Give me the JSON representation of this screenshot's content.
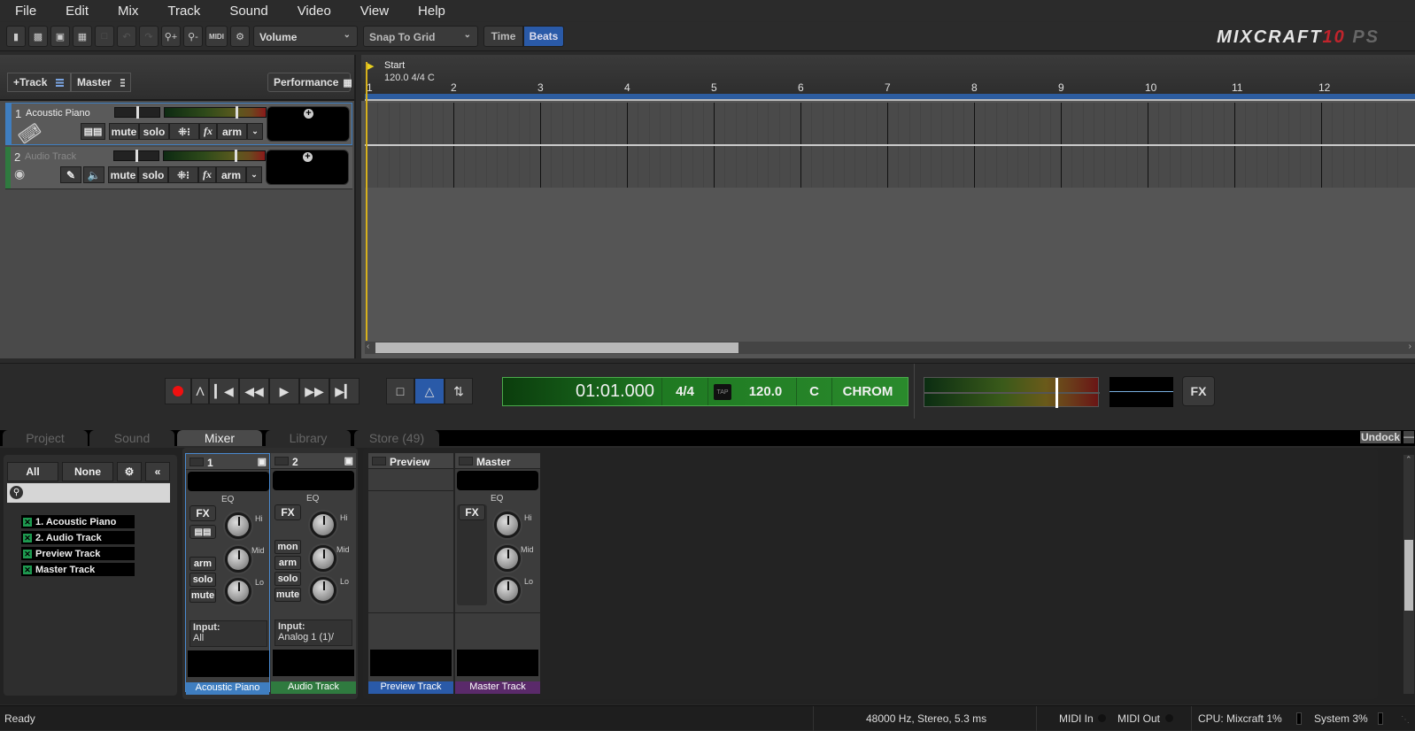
{
  "menu": [
    "File",
    "Edit",
    "Mix",
    "Track",
    "Sound",
    "Video",
    "View",
    "Help"
  ],
  "toolbar": {
    "icons": [
      "new-file-icon",
      "open-folder-icon",
      "open-project-icon",
      "save-icon",
      "crop-icon",
      "undo-icon",
      "redo-icon",
      "zoom-in-icon",
      "zoom-out-icon",
      "midi-icon",
      "settings-icon"
    ],
    "midi_label": "MIDI",
    "automation_dropdown": "Volume",
    "snap_dropdown": "Snap To Grid",
    "time_label": "Time",
    "beats_label": "Beats",
    "beats_active": true
  },
  "logo": {
    "name": "MIXCRAFT",
    "version": "10",
    "edition": "PS"
  },
  "track_panel": {
    "add_track": "+Track",
    "master": "Master",
    "performance": "Performance",
    "tracks": [
      {
        "num": "1",
        "name": "Acoustic Piano",
        "color": "#3f7ec0",
        "type": "instrument",
        "buttons": [
          "mute",
          "solo",
          "fx",
          "arm"
        ]
      },
      {
        "num": "2",
        "name": "Audio Track",
        "color": "#2f7a3f",
        "type": "audio",
        "buttons": [
          "mute",
          "solo",
          "fx",
          "arm"
        ]
      }
    ]
  },
  "timeline": {
    "marker_label": "Start",
    "marker_info": "120.0 4/4 C",
    "bars": [
      "1",
      "2",
      "3",
      "4",
      "5",
      "6",
      "7",
      "8",
      "9",
      "10",
      "11",
      "12"
    ]
  },
  "transport": {
    "time": "01:01.000",
    "meter": "4/4",
    "tap": "TAP",
    "tempo": "120.0",
    "key": "C",
    "scale": "CHROM",
    "fx_label": "FX",
    "metronome_active": true
  },
  "tabs": [
    {
      "label": "Project",
      "active": false
    },
    {
      "label": "Sound",
      "active": false
    },
    {
      "label": "Mixer",
      "active": true
    },
    {
      "label": "Library",
      "active": false
    },
    {
      "label": "Store (49)",
      "active": false
    }
  ],
  "undock": "Undock",
  "mixer": {
    "filter_all": "All",
    "filter_none": "None",
    "search_placeholder": "",
    "track_list": [
      "1. Acoustic Piano",
      "2. Audio Track",
      "Preview Track",
      "Master Track"
    ],
    "eq_label": "EQ",
    "knob_labels": [
      "Hi",
      "Mid",
      "Lo"
    ],
    "strips": [
      {
        "header": "1",
        "label": "Acoustic Piano",
        "color": "#3f7ec0",
        "buttons": [
          "arm",
          "solo",
          "mute"
        ],
        "input_label": "Input:",
        "input_value": "All"
      },
      {
        "header": "2",
        "label": "Audio Track",
        "color": "#2f7a3f",
        "buttons": [
          "mon",
          "arm",
          "solo",
          "mute"
        ],
        "input_label": "Input:",
        "input_value": "Analog 1 (1)/"
      },
      {
        "header": "Preview",
        "label": "Preview Track",
        "color": "#2a5aa8"
      },
      {
        "header": "Master",
        "label": "Master Track",
        "color": "#5a2a6a"
      }
    ],
    "fx_label": "FX"
  },
  "status": {
    "left": "Ready",
    "audio": "48000 Hz, Stereo, 5.3 ms",
    "midi_in": "MIDI In",
    "midi_out": "MIDI Out",
    "cpu": "CPU: Mixcraft 1%",
    "system": "System 3%"
  }
}
